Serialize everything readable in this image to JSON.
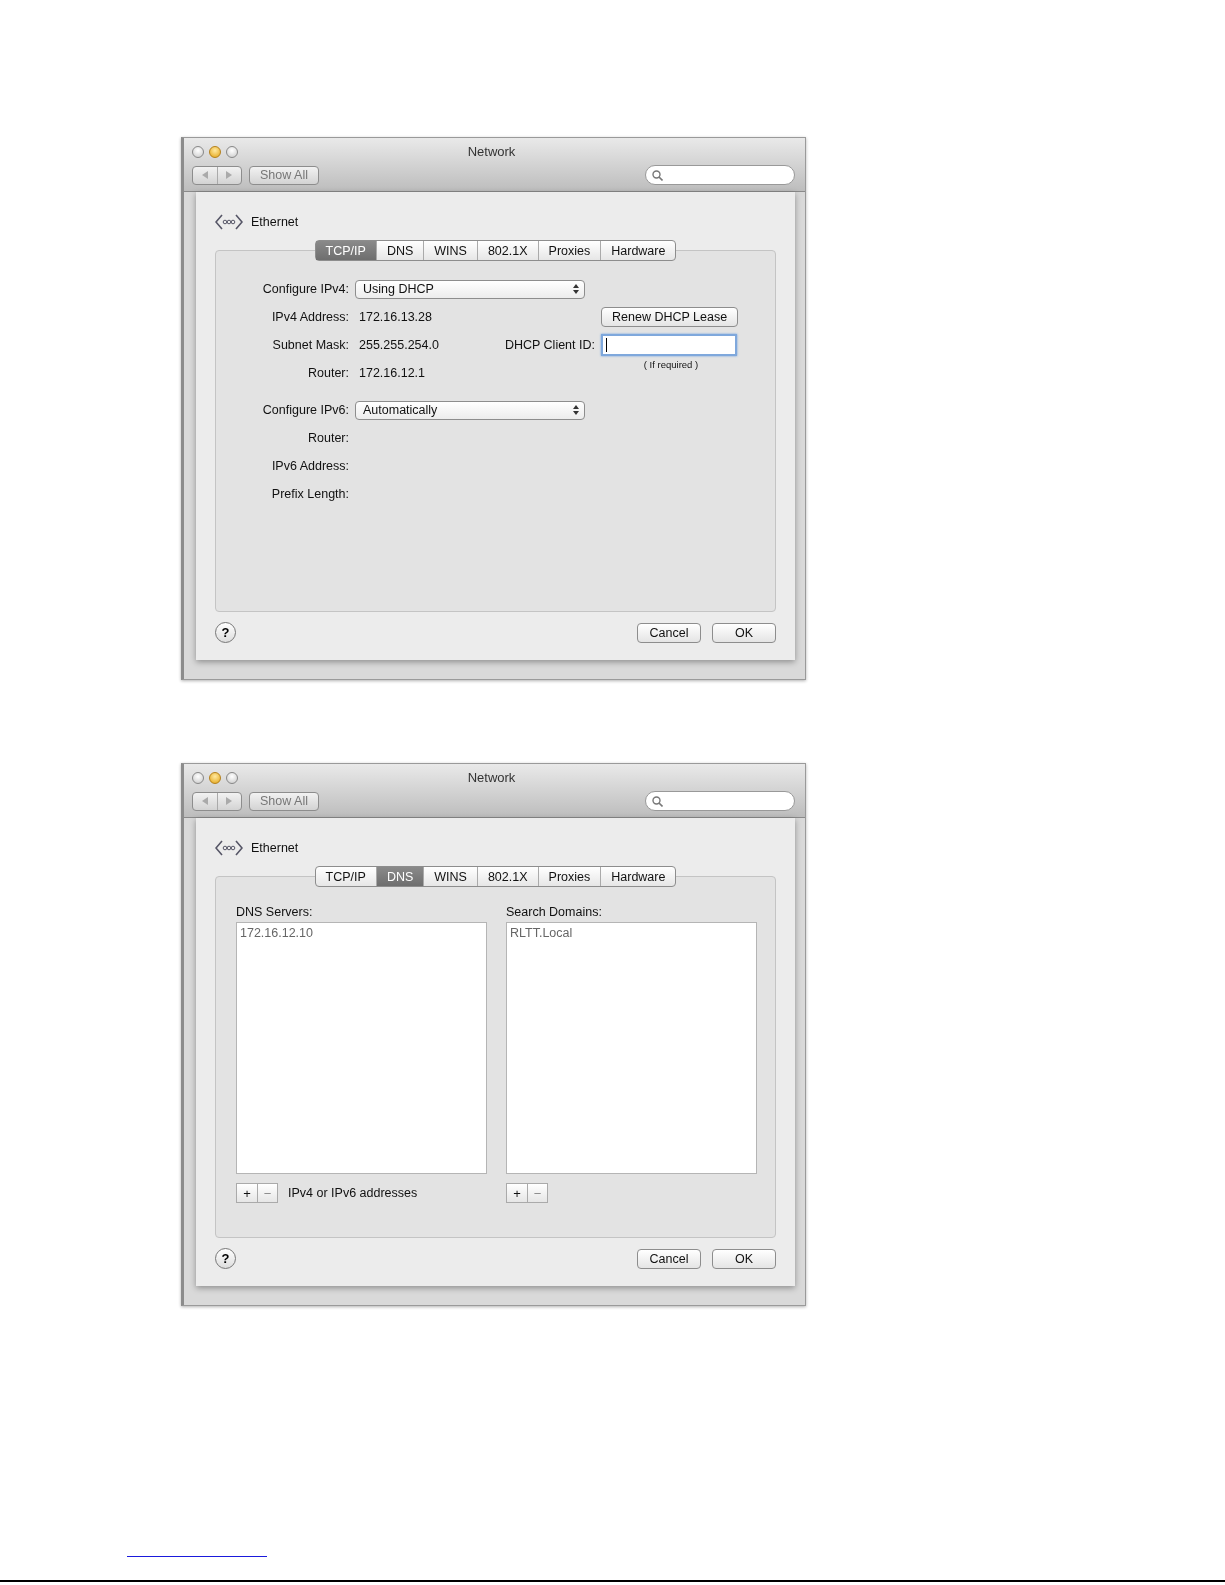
{
  "windows": [
    {
      "title": "Network",
      "show_all": "Show All",
      "service": "Ethernet",
      "tabs": [
        {
          "label": "TCP/IP",
          "selected": true
        },
        {
          "label": "DNS",
          "selected": false
        },
        {
          "label": "WINS",
          "selected": false
        },
        {
          "label": "802.1X",
          "selected": false
        },
        {
          "label": "Proxies",
          "selected": false
        },
        {
          "label": "Hardware",
          "selected": false
        }
      ],
      "pane": {
        "kind": "tcpip",
        "rows": [
          {
            "kind": "popup",
            "label": "Configure IPv4:",
            "value": "Using DHCP"
          },
          {
            "kind": "value",
            "label": "IPv4 Address:",
            "value": "172.16.13.28"
          },
          {
            "kind": "value",
            "label": "Subnet Mask:",
            "value": "255.255.254.0"
          },
          {
            "kind": "value",
            "label": "Router:",
            "value": "172.16.12.1"
          },
          {
            "kind": "popup",
            "label": "Configure IPv6:",
            "value": "Automatically"
          },
          {
            "kind": "value",
            "label": "Router:"
          },
          {
            "kind": "value",
            "label": "IPv6 Address:"
          },
          {
            "kind": "value",
            "label": "Prefix Length:"
          }
        ],
        "renew_button": "Renew DHCP Lease",
        "client_id": {
          "label": "DHCP Client ID:",
          "focused": true,
          "hint": "( If required )"
        }
      },
      "help": "?",
      "buttons": [
        "Cancel",
        "OK"
      ]
    },
    {
      "title": "Network",
      "show_all": "Show All",
      "service": "Ethernet",
      "tabs": [
        {
          "label": "TCP/IP",
          "selected": false
        },
        {
          "label": "DNS",
          "selected": true
        },
        {
          "label": "WINS",
          "selected": false
        },
        {
          "label": "802.1X",
          "selected": false
        },
        {
          "label": "Proxies",
          "selected": false
        },
        {
          "label": "Hardware",
          "selected": false
        }
      ],
      "pane": {
        "kind": "dns",
        "lists": [
          {
            "label": "DNS Servers:",
            "items": [
              "172.16.12.10"
            ],
            "add": "+",
            "remove": "−",
            "hint": "IPv4 or IPv6 addresses"
          },
          {
            "label": "Search Domains:",
            "items": [
              "RLTT.Local"
            ],
            "add": "+",
            "remove": "−"
          }
        ]
      },
      "help": "?",
      "buttons": [
        "Cancel",
        "OK"
      ]
    }
  ]
}
